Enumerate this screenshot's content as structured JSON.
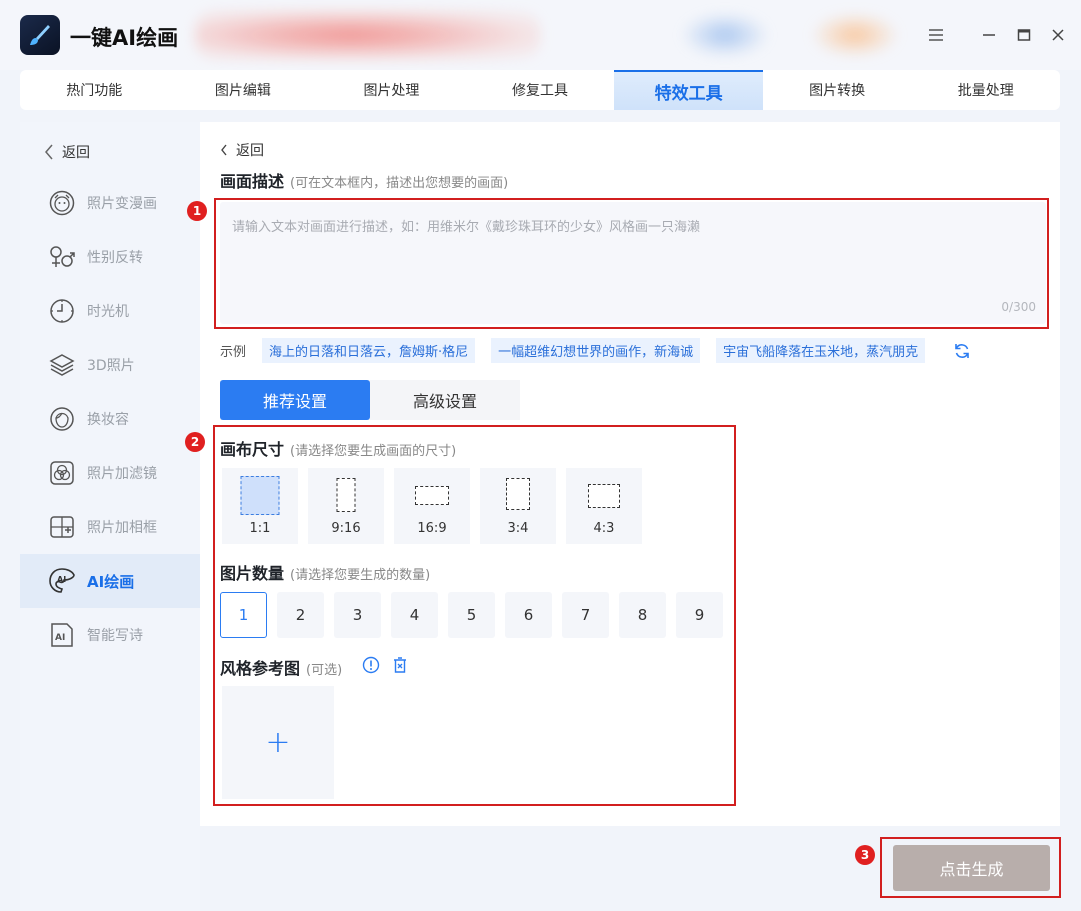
{
  "app": {
    "title": "一键AI绘画"
  },
  "top_nav": [
    {
      "label": "热门功能"
    },
    {
      "label": "图片编辑"
    },
    {
      "label": "图片处理"
    },
    {
      "label": "修复工具"
    },
    {
      "label": "特效工具",
      "active": true
    },
    {
      "label": "图片转换"
    },
    {
      "label": "批量处理"
    }
  ],
  "sidebar": {
    "back_label": "返回",
    "items": [
      {
        "label": "照片变漫画",
        "icon": "cartoon-face-icon"
      },
      {
        "label": "性别反转",
        "icon": "gender-icon"
      },
      {
        "label": "时光机",
        "icon": "clock-icon"
      },
      {
        "label": "3D照片",
        "icon": "layers-icon"
      },
      {
        "label": "换妆容",
        "icon": "makeup-icon"
      },
      {
        "label": "照片加滤镜",
        "icon": "filter-icon"
      },
      {
        "label": "照片加相框",
        "icon": "frame-icon"
      },
      {
        "label": "AI绘画",
        "icon": "ai-paint-icon",
        "active": true
      },
      {
        "label": "智能写诗",
        "icon": "ai-poem-icon"
      }
    ]
  },
  "main": {
    "back_label": "返回",
    "description": {
      "title": "画面描述",
      "hint": "(可在文本框内，描述出您想要的画面)",
      "placeholder": "请输入文本对画面进行描述，如：用维米尔《戴珍珠耳环的少女》风格画一只海濑",
      "value": "",
      "counter": "0/300"
    },
    "examples": {
      "label": "示例",
      "items": [
        "海上的日落和日落云，詹姆斯·格尼",
        "一幅超维幻想世界的画作，新海诚",
        "宇宙飞船降落在玉米地，蒸汽朋克"
      ]
    },
    "settings_tabs": [
      {
        "label": "推荐设置",
        "active": true
      },
      {
        "label": "高级设置"
      }
    ],
    "canvas_size": {
      "title": "画布尺寸",
      "hint": "(请选择您要生成画面的尺寸)",
      "options": [
        "1:1",
        "9:16",
        "16:9",
        "3:4",
        "4:3"
      ],
      "selected": "1:1"
    },
    "image_count": {
      "title": "图片数量",
      "hint": "(请选择您要生成的数量)",
      "options": [
        "1",
        "2",
        "3",
        "4",
        "5",
        "6",
        "7",
        "8",
        "9"
      ],
      "selected": "1"
    },
    "style_ref": {
      "title": "风格参考图",
      "hint": "(可选)",
      "add_symbol": "+"
    }
  },
  "annotations": [
    "1",
    "2",
    "3"
  ],
  "generate_button": {
    "label": "点击生成"
  },
  "colors": {
    "accent": "#2b7cf2",
    "annotation": "#d21f1f",
    "generate_disabled": "#b8aeab"
  }
}
